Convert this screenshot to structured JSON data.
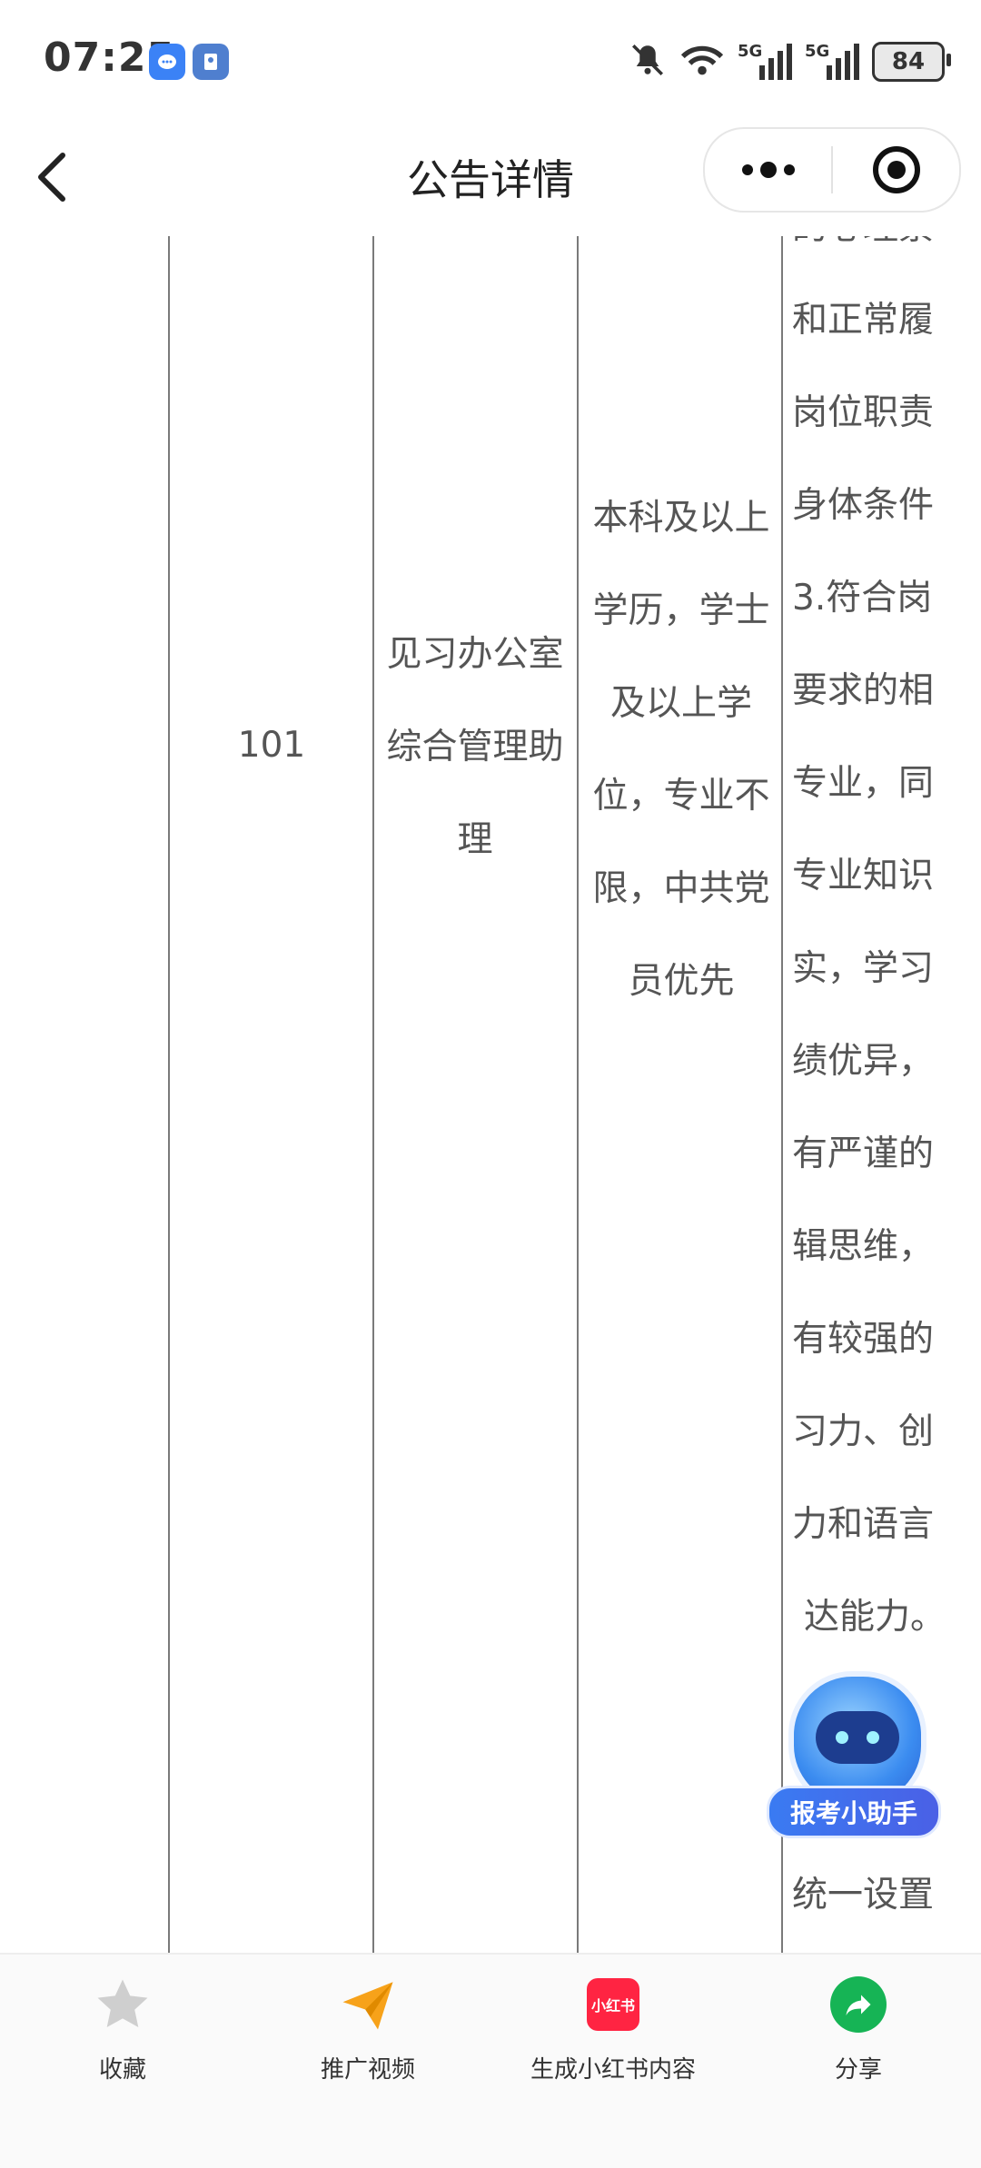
{
  "status_bar": {
    "time": "07:25",
    "battery": "84",
    "signal_1": "5G",
    "signal_2": "5G"
  },
  "nav": {
    "title": "公告详情"
  },
  "table": {
    "position_code": "101",
    "position_name_lines": [
      "见习办公室",
      "综合管理助",
      "理"
    ],
    "education_lines": [
      "本科及以上",
      "学历，学士",
      "及以上学",
      "位，专业不",
      "限，中共党",
      "员优先"
    ],
    "requirement_lines": [
      "的心理素",
      "和正常履",
      "岗位职责",
      "身体条件",
      "3.符合岗",
      "要求的相",
      "专业，同",
      "专业知识",
      "实，学习",
      "绩优异，",
      "有严谨的",
      "辑思维，",
      "有较强的",
      "习力、创",
      "力和语言",
      "达能力。",
      "",
      "",
      "统一设置"
    ]
  },
  "assistant": {
    "label": "报考小助手"
  },
  "toolbar": {
    "favorite": "收藏",
    "promo_video": "推广视频",
    "xiaohongshu": "生成小红书内容",
    "xiaohongshu_badge": "小红书",
    "share": "分享"
  },
  "colors": {
    "share_green": "#16b455",
    "xhs_red": "#ff2442",
    "promo_orange": "#f7a21a",
    "star_gray": "#cfcfcf"
  }
}
